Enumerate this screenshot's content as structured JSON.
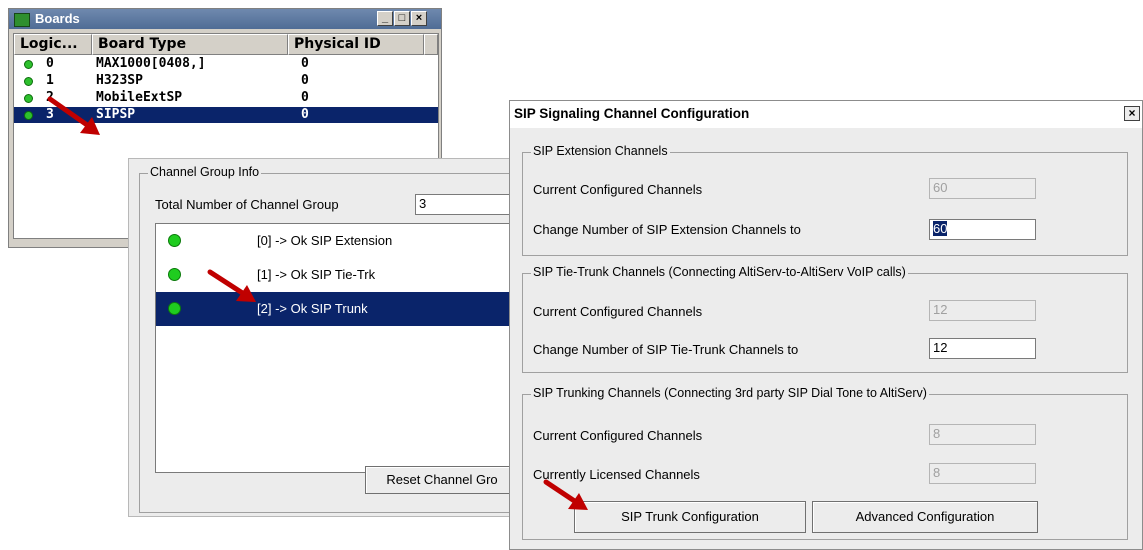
{
  "boards_window": {
    "title": "Boards",
    "controls": {
      "minimize": "_",
      "maximize": "□",
      "close": "×"
    },
    "columns": [
      "Logic...",
      "Board Type",
      "Physical ID"
    ],
    "rows": [
      {
        "logic": "0",
        "type": "MAX1000[0408,]",
        "physical_id": "0",
        "status": "green",
        "selected": false
      },
      {
        "logic": "1",
        "type": "H323SP",
        "physical_id": "0",
        "status": "green",
        "selected": false
      },
      {
        "logic": "2",
        "type": "MobileExtSP",
        "physical_id": "0",
        "status": "green",
        "selected": false
      },
      {
        "logic": "3",
        "type": "SIPSP",
        "physical_id": "0",
        "status": "green",
        "selected": true
      }
    ]
  },
  "channel_group_info": {
    "legend": "Channel Group Info",
    "total_label": "Total Number of Channel Group",
    "total_value": "3",
    "items": [
      {
        "text": "[0] -> Ok  SIP Extension",
        "selected": false
      },
      {
        "text": "[1] -> Ok  SIP Tie-Trk",
        "selected": false
      },
      {
        "text": "[2] -> Ok  SIP Trunk",
        "selected": true
      }
    ],
    "reset_button": "Reset Channel Gro"
  },
  "sip_dialog": {
    "title": "SIP Signaling Channel Configuration",
    "close": "×",
    "extension": {
      "legend": "SIP Extension Channels",
      "current_label": "Current Configured Channels",
      "current_value": "60",
      "change_label": "Change Number of SIP Extension Channels to",
      "change_value": "60"
    },
    "tie_trunk": {
      "legend": "SIP Tie-Trunk Channels (Connecting AltiServ-to-AltiServ VoIP calls)",
      "current_label": "Current Configured Channels",
      "current_value": "12",
      "change_label": "Change Number of SIP Tie-Trunk Channels to",
      "change_value": "12"
    },
    "trunking": {
      "legend": "SIP Trunking Channels (Connecting 3rd party SIP Dial Tone to AltiServ)",
      "current_label": "Current Configured Channels",
      "current_value": "8",
      "licensed_label": "Currently Licensed Channels",
      "licensed_value": "8"
    },
    "buttons": {
      "sip_trunk_config": "SIP Trunk Configuration",
      "advanced_config": "Advanced Configuration"
    }
  },
  "colors": {
    "selection": "#0a246a",
    "arrow": "#c00000",
    "status_green": "#2ec02e"
  }
}
